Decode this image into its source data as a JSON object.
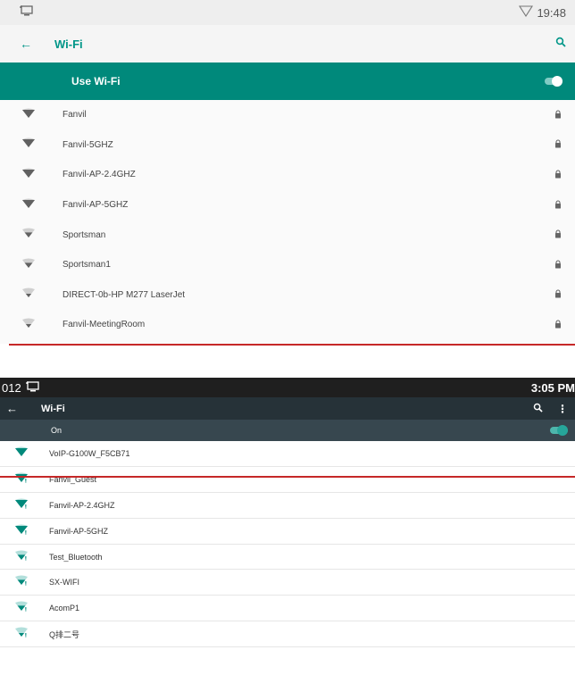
{
  "colors": {
    "accent": "#00897b",
    "accent_light": "#80cbc4",
    "divider": "#c62828",
    "dark_status": "#1f1f1f",
    "dark_appbar": "#263238",
    "dark_onbar": "#37474f"
  },
  "top": {
    "status": {
      "time": "19:48",
      "left_icon": "screen-cast-icon",
      "right_icon": "wifi-outline-icon"
    },
    "app_bar": {
      "title": "Wi-Fi",
      "back_icon": "back-arrow-icon",
      "search_icon": "search-icon"
    },
    "use_wifi": {
      "label": "Use Wi-Fi",
      "enabled": true
    },
    "networks": [
      {
        "name": "Fanvil",
        "strength": 1.0,
        "secured": true
      },
      {
        "name": "Fanvil-5GHZ",
        "strength": 1.0,
        "secured": true
      },
      {
        "name": "Fanvil-AP-2.4GHZ",
        "strength": 1.0,
        "secured": true
      },
      {
        "name": "Fanvil-AP-5GHZ",
        "strength": 1.0,
        "secured": true
      },
      {
        "name": "Sportsman",
        "strength": 0.66,
        "secured": true
      },
      {
        "name": "Sportsman1",
        "strength": 0.66,
        "secured": true
      },
      {
        "name": "DIRECT-0b-HP M277 LaserJet",
        "strength": 0.5,
        "secured": true
      },
      {
        "name": "Fanvil-MeetingRoom",
        "strength": 0.5,
        "secured": true
      }
    ]
  },
  "bottom": {
    "status": {
      "left_text": "012",
      "time": "3:05 PM",
      "left_icon": "screen-cast-icon"
    },
    "app_bar": {
      "title": "Wi-Fi",
      "back_icon": "back-arrow-icon",
      "search_icon": "search-icon",
      "more_icon": "more-vert-icon"
    },
    "wifi_state": {
      "label": "On",
      "enabled": true
    },
    "networks": [
      {
        "name": "VoIP-G100W_F5CB71",
        "strength": 1.0,
        "no_internet": false
      },
      {
        "name": "Fanvil_Guest",
        "strength": 1.0,
        "no_internet": true
      },
      {
        "name": "Fanvil-AP-2.4GHZ",
        "strength": 1.0,
        "no_internet": true
      },
      {
        "name": "Fanvil-AP-5GHZ",
        "strength": 1.0,
        "no_internet": true
      },
      {
        "name": "Test_Bluetooth",
        "strength": 0.66,
        "no_internet": true
      },
      {
        "name": "SX-WIFI",
        "strength": 0.66,
        "no_internet": true
      },
      {
        "name": "AcomP1",
        "strength": 0.66,
        "no_internet": true
      },
      {
        "name": "Q排二号",
        "strength": 0.5,
        "no_internet": true
      }
    ]
  }
}
